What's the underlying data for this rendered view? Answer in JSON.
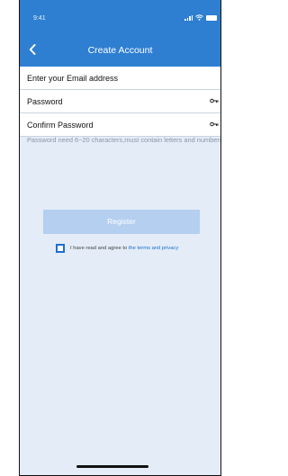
{
  "status_bar": {
    "time": "9:41"
  },
  "nav": {
    "title": "Create Account",
    "back_icon": "chevron-left-icon"
  },
  "form": {
    "email_placeholder": "Enter your Email address",
    "password_placeholder": "Password",
    "confirm_password_placeholder": "Confirm Password",
    "password_visibility_icon": "key-icon"
  },
  "hint": "Password need 6~20 characters,must contain letters and numbers.",
  "register_label": "Register",
  "agreement": {
    "text": "I have read and agree to",
    "link_text": "the terms and privacy"
  },
  "colors": {
    "header": "#2e7fd1",
    "background": "#e3ecf7",
    "register_button": "#b5cff0",
    "link": "#1c6fd0"
  }
}
